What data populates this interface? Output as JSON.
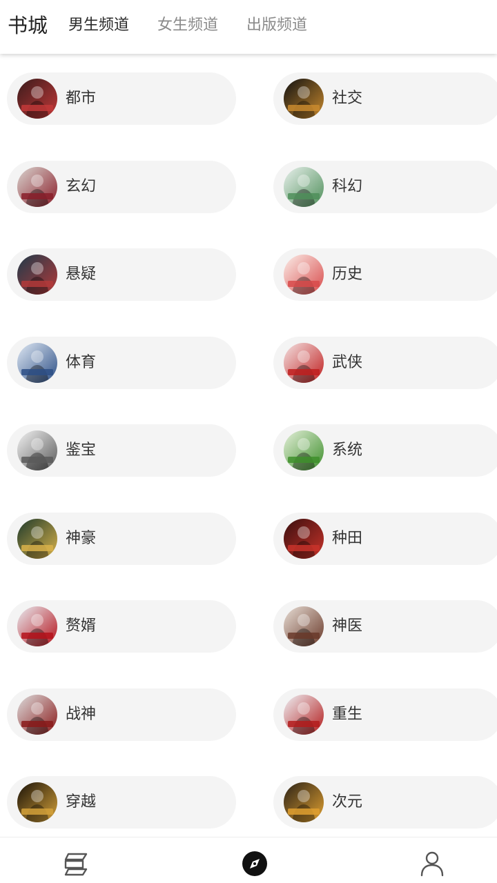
{
  "header": {
    "title": "书城",
    "tabs": [
      {
        "label": "男生频道",
        "active": true
      },
      {
        "label": "女生频道",
        "active": false
      },
      {
        "label": "出版频道",
        "active": false
      }
    ]
  },
  "categories": [
    {
      "label": "都市",
      "cover_colors": [
        "#3a1c1c",
        "#c23838"
      ]
    },
    {
      "label": "社交",
      "cover_colors": [
        "#111111",
        "#c98a2e"
      ]
    },
    {
      "label": "玄幻",
      "cover_colors": [
        "#d9d4cf",
        "#8a1e2a"
      ]
    },
    {
      "label": "科幻",
      "cover_colors": [
        "#e8f0ec",
        "#4f8f5a"
      ]
    },
    {
      "label": "悬疑",
      "cover_colors": [
        "#1f3a4a",
        "#b33a3a"
      ]
    },
    {
      "label": "历史",
      "cover_colors": [
        "#fbeee9",
        "#d84a4a"
      ]
    },
    {
      "label": "体育",
      "cover_colors": [
        "#dfe8f3",
        "#2d4f86"
      ]
    },
    {
      "label": "武侠",
      "cover_colors": [
        "#f3e2e2",
        "#c01f1f"
      ]
    },
    {
      "label": "鉴宝",
      "cover_colors": [
        "#f2f2f2",
        "#5a5a5a"
      ]
    },
    {
      "label": "系统",
      "cover_colors": [
        "#e4efd9",
        "#3e8f2c"
      ]
    },
    {
      "label": "神豪",
      "cover_colors": [
        "#1e3a2c",
        "#d9b24a"
      ]
    },
    {
      "label": "种田",
      "cover_colors": [
        "#3a0f0f",
        "#c8332a"
      ]
    },
    {
      "label": "赘婿",
      "cover_colors": [
        "#e8ecf1",
        "#b5121b"
      ]
    },
    {
      "label": "神医",
      "cover_colors": [
        "#e7ddd5",
        "#6a3a2a"
      ]
    },
    {
      "label": "战神",
      "cover_colors": [
        "#dcdcdc",
        "#8a1a1a"
      ]
    },
    {
      "label": "重生",
      "cover_colors": [
        "#eef1f5",
        "#b31c1c"
      ]
    },
    {
      "label": "穿越",
      "cover_colors": [
        "#1a1208",
        "#d4a13a"
      ]
    },
    {
      "label": "次元",
      "cover_colors": [
        "#2b2218",
        "#e0a030"
      ]
    }
  ],
  "bottom_nav": [
    {
      "icon": "bookshelf-icon",
      "active": false
    },
    {
      "icon": "compass-icon",
      "active": true
    },
    {
      "icon": "user-icon",
      "active": false
    }
  ]
}
